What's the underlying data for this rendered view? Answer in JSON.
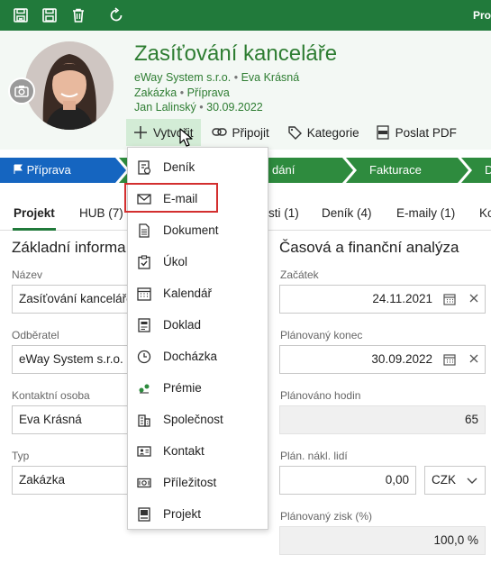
{
  "toolbar": {
    "icons": [
      "save-close-icon",
      "save-icon",
      "trash-icon",
      "refresh-icon"
    ],
    "right_label": "Pro"
  },
  "record": {
    "title": "Zasíťování kanceláře",
    "company": "eWay System s.r.o.",
    "contact": "Eva Krásná",
    "type": "Zakázka",
    "stage": "Příprava",
    "owner": "Jan Lalinský",
    "date": "30.09.2022",
    "separator": "•"
  },
  "actions": [
    {
      "label": "Vytvořit",
      "icon": "plus-icon"
    },
    {
      "label": "Připojit",
      "icon": "link-icon"
    },
    {
      "label": "Kategorie",
      "icon": "tag-icon"
    },
    {
      "label": "Poslat PDF",
      "icon": "pdf-icon"
    }
  ],
  "pipeline": {
    "stages": [
      "Příprava",
      "dání",
      "Fakturace",
      "D"
    ],
    "active": "Příprava",
    "colors": {
      "active": "#1565c0",
      "inactive": "#2e8b3e"
    }
  },
  "tabs": [
    {
      "label": "Projekt",
      "active": true
    },
    {
      "label": "HUB (7)"
    },
    {
      "label": "sti (1)"
    },
    {
      "label": "Deník (4)"
    },
    {
      "label": "E-maily (1)"
    },
    {
      "label": "Ko"
    }
  ],
  "left_section": {
    "title": "Základní informa",
    "fields": [
      {
        "label": "Název",
        "value": "Zasíťování kanceláře"
      },
      {
        "label": "Odběratel",
        "value": "eWay System s.r.o."
      },
      {
        "label": "Kontaktní osoba",
        "value": "Eva Krásná"
      },
      {
        "label": "Typ",
        "value": "Zakázka"
      }
    ]
  },
  "right_section": {
    "title": "Časová a finanční analýza",
    "start": {
      "label": "Začátek",
      "value": "24.11.2021"
    },
    "planned_end": {
      "label": "Plánovaný konec",
      "value": "30.09.2022"
    },
    "planned_hours": {
      "label": "Plánováno hodin",
      "value": "65"
    },
    "planned_people_cost": {
      "label": "Plán. nákl. lidí",
      "value": "0,00",
      "currency": "CZK"
    },
    "planned_profit": {
      "label": "Plánovaný zisk (%)",
      "value": "100,0 %"
    }
  },
  "create_menu": {
    "items": [
      {
        "label": "Deník",
        "icon": "journal-icon"
      },
      {
        "label": "E-mail",
        "icon": "envelope-icon",
        "highlighted": true
      },
      {
        "label": "Dokument",
        "icon": "document-icon"
      },
      {
        "label": "Úkol",
        "icon": "task-icon"
      },
      {
        "label": "Kalendář",
        "icon": "calendar-icon"
      },
      {
        "label": "Doklad",
        "icon": "receipt-icon"
      },
      {
        "label": "Docházka",
        "icon": "clock-icon"
      },
      {
        "label": "Prémie",
        "icon": "bonus-icon"
      },
      {
        "label": "Společnost",
        "icon": "building-icon"
      },
      {
        "label": "Kontakt",
        "icon": "contact-card-icon"
      },
      {
        "label": "Příležitost",
        "icon": "opportunity-icon"
      },
      {
        "label": "Projekt",
        "icon": "project-icon"
      }
    ]
  },
  "colors": {
    "brand_green": "#217a3b",
    "title_green": "#2e7d32",
    "highlight_red": "#d32f2f"
  }
}
